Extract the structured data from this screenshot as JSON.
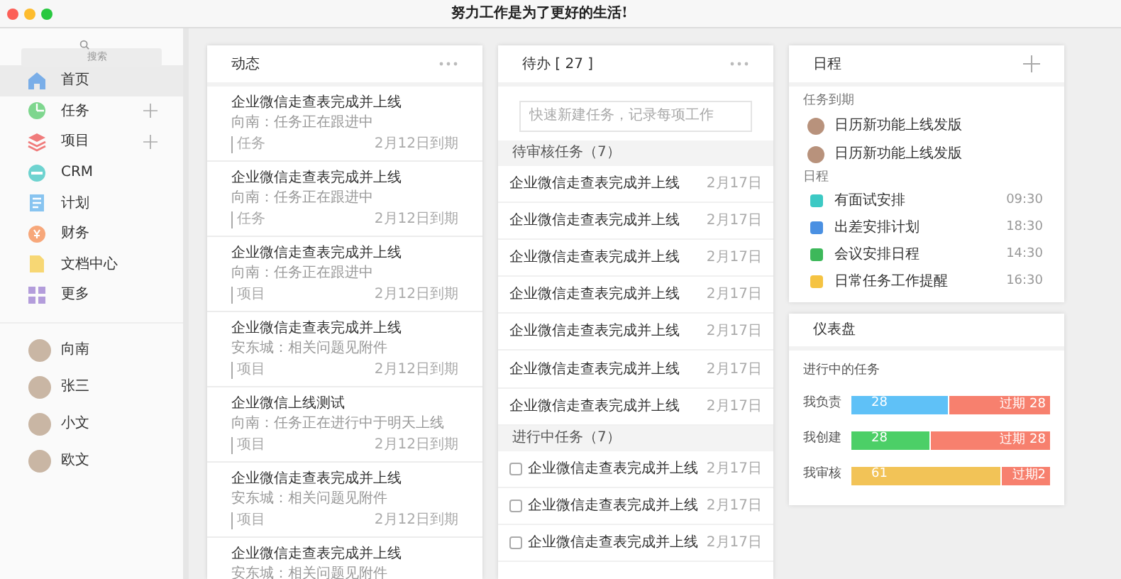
{
  "window": {
    "title": "努力工作是为了更好的生活!"
  },
  "sidebar": {
    "search": {
      "placeholder": "搜索"
    },
    "items": [
      {
        "label": "首页",
        "selected": true,
        "add_button": false
      },
      {
        "label": "任务",
        "selected": false,
        "add_button": true
      },
      {
        "label": "项目",
        "selected": false,
        "add_button": true
      },
      {
        "label": "CRM",
        "selected": false,
        "add_button": false
      },
      {
        "label": "计划",
        "selected": false,
        "add_button": false
      },
      {
        "label": "财务",
        "selected": false,
        "add_button": false
      },
      {
        "label": "文档中心",
        "selected": false,
        "add_button": false
      },
      {
        "label": "更多",
        "selected": false,
        "add_button": false
      }
    ],
    "people": [
      {
        "name": "向南"
      },
      {
        "name": "张三"
      },
      {
        "name": "小文"
      },
      {
        "name": "欧文"
      }
    ]
  },
  "feed": {
    "title": "动态",
    "items": [
      {
        "title": "企业微信走查表完成并上线",
        "subtitle": "向南：任务正在跟进中",
        "tag": "任务",
        "due": "2月12日到期"
      },
      {
        "title": "企业微信走查表完成并上线",
        "subtitle": "向南：任务正在跟进中",
        "tag": "任务",
        "due": "2月12日到期"
      },
      {
        "title": "企业微信走查表完成并上线",
        "subtitle": "向南：任务正在跟进中",
        "tag": "项目",
        "due": "2月12日到期"
      },
      {
        "title": "企业微信走查表完成并上线",
        "subtitle": "安东城：相关问题见附件",
        "tag": "项目",
        "due": "2月12日到期"
      },
      {
        "title": "企业微信上线测试",
        "subtitle": "向南：任务正在进行中于明天上线",
        "tag": "项目",
        "due": "2月12日到期"
      },
      {
        "title": "企业微信走查表完成并上线",
        "subtitle": "安东城：相关问题见附件",
        "tag": "项目",
        "due": "2月12日到期"
      },
      {
        "title": "企业微信走查表完成并上线",
        "subtitle": "安东城：相关问题见附件"
      }
    ]
  },
  "todo": {
    "title": "待办 [ 27 ]",
    "input": {
      "placeholder": "快速新建任务，记录每项工作"
    },
    "sections": [
      {
        "title": "待审核任务（7）",
        "kind": "plain",
        "rows": [
          {
            "title": "企业微信走查表完成并上线",
            "date": "2月17日"
          },
          {
            "title": "企业微信走查表完成并上线",
            "date": "2月17日"
          },
          {
            "title": "企业微信走查表完成并上线",
            "date": "2月17日"
          },
          {
            "title": "企业微信走查表完成并上线",
            "date": "2月17日"
          },
          {
            "title": "企业微信走查表完成并上线",
            "date": "2月17日"
          },
          {
            "title": "企业微信走查表完成并上线",
            "date": "2月17日"
          },
          {
            "title": "企业微信走查表完成并上线",
            "date": "2月17日"
          }
        ]
      },
      {
        "title": "进行中任务（7）",
        "kind": "checkbox",
        "rows": [
          {
            "title": "企业微信走查表完成并上线",
            "date": "2月17日",
            "checked": false
          },
          {
            "title": "企业微信走查表完成并上线",
            "date": "2月17日",
            "checked": false
          },
          {
            "title": "企业微信走查表完成并上线",
            "date": "2月17日",
            "checked": false
          }
        ]
      }
    ]
  },
  "schedule": {
    "title": "日程",
    "due_label": "任务到期",
    "due_items": [
      {
        "label": "日历新功能上线发版"
      },
      {
        "label": "日历新功能上线发版"
      }
    ],
    "events_label": "日程",
    "events": [
      {
        "label": "有面试安排",
        "time": "09:30",
        "color": "#3cc9c4"
      },
      {
        "label": "出差安排计划",
        "time": "18:30",
        "color": "#4a90e2"
      },
      {
        "label": "会议安排日程",
        "time": "14:30",
        "color": "#3db85a"
      },
      {
        "label": "日常任务工作提醒",
        "time": "16:30",
        "color": "#f5c342"
      }
    ]
  },
  "dashboard": {
    "title": "仪表盘",
    "subtitle": "进行中的任务",
    "bars": [
      {
        "label": "我负责",
        "value": "28",
        "overdue": "过期 28",
        "level": 0.49,
        "color": "#5fc1f7"
      },
      {
        "label": "我创建",
        "value": "28",
        "overdue": "过期 28",
        "level": 0.4,
        "color": "#4ccf67"
      },
      {
        "label": "我审核",
        "value": "61",
        "overdue": "过期2",
        "level": 0.76,
        "color": "#f2c357"
      }
    ]
  }
}
